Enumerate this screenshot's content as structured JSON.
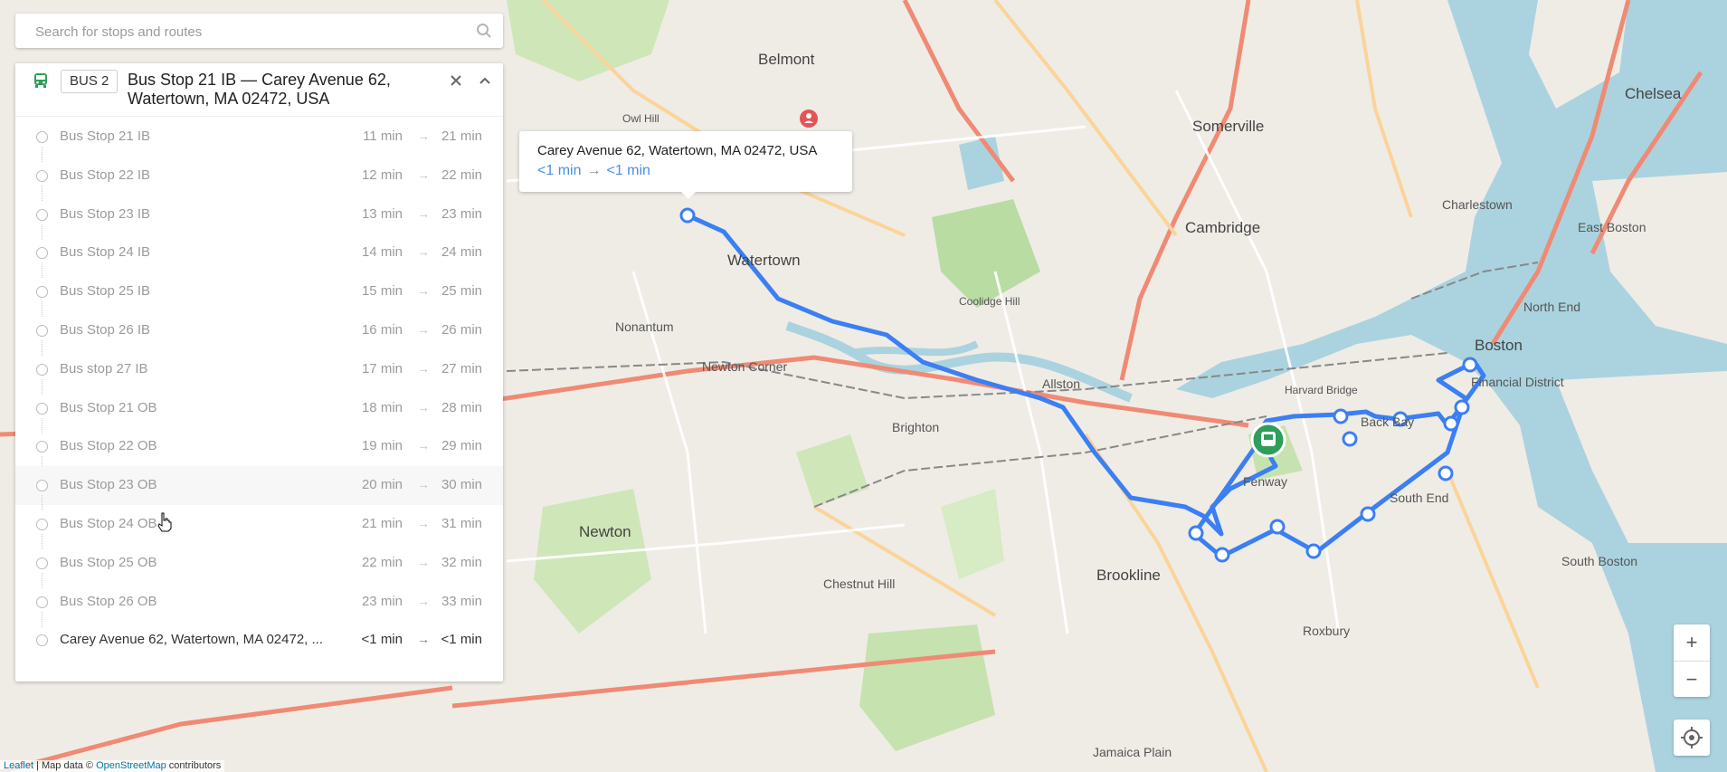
{
  "search": {
    "placeholder": "Search for stops and routes"
  },
  "panel": {
    "route_badge": "BUS 2",
    "title": "Bus Stop 21 IB — Carey Avenue 62, Watertown, MA 02472, USA",
    "stops": [
      {
        "name": "Bus Stop 21 IB",
        "arrive": "11 min",
        "depart": "21 min"
      },
      {
        "name": "Bus Stop 22 IB",
        "arrive": "12 min",
        "depart": "22 min"
      },
      {
        "name": "Bus Stop 23 IB",
        "arrive": "13 min",
        "depart": "23 min"
      },
      {
        "name": "Bus Stop 24 IB",
        "arrive": "14 min",
        "depart": "24 min"
      },
      {
        "name": "Bus Stop 25 IB",
        "arrive": "15 min",
        "depart": "25 min"
      },
      {
        "name": "Bus Stop 26 IB",
        "arrive": "16 min",
        "depart": "26 min"
      },
      {
        "name": "Bus stop 27 IB",
        "arrive": "17 min",
        "depart": "27 min"
      },
      {
        "name": "Bus Stop 21 OB",
        "arrive": "18 min",
        "depart": "28 min"
      },
      {
        "name": "Bus Stop 22 OB",
        "arrive": "19 min",
        "depart": "29 min"
      },
      {
        "name": "Bus Stop 23 OB",
        "arrive": "20 min",
        "depart": "30 min"
      },
      {
        "name": "Bus Stop 24 OB",
        "arrive": "21 min",
        "depart": "31 min"
      },
      {
        "name": "Bus Stop 25 OB",
        "arrive": "22 min",
        "depart": "32 min"
      },
      {
        "name": "Bus Stop 26 OB",
        "arrive": "23 min",
        "depart": "33 min"
      },
      {
        "name": "Carey Avenue 62, Watertown, MA 02472, ...",
        "arrive": "<1 min",
        "depart": "<1 min"
      }
    ],
    "arrow": "→"
  },
  "popup": {
    "address": "Carey Avenue 62, Watertown, MA 02472, USA",
    "arrive": "<1 min",
    "depart": "<1 min",
    "arrow": "→"
  },
  "map": {
    "labels": [
      "Belmont",
      "Somerville",
      "Chelsea",
      "Charlestown",
      "East Boston",
      "Cambridge",
      "North End",
      "Boston",
      "Financial District",
      "Watertown",
      "Nonantum",
      "Newton Corner",
      "Allston",
      "Brighton",
      "Fenway",
      "Back Bay",
      "South End",
      "Newton",
      "Brookline",
      "Chestnut Hill",
      "Roxbury",
      "South Boston",
      "Jamaica Plain",
      "Harvard Bridge",
      "Owl Hill",
      "Coolidge Hill"
    ]
  },
  "zoom": {
    "in": "+",
    "out": "−"
  },
  "attribution": {
    "leaflet": "Leaflet",
    "sep": " | Map data © ",
    "osm": "OpenStreetMap",
    "tail": " contributors"
  },
  "colors": {
    "route": "#3b7ff2",
    "bus_marker": "#2e9e5b",
    "accent": "#4a90e2"
  }
}
